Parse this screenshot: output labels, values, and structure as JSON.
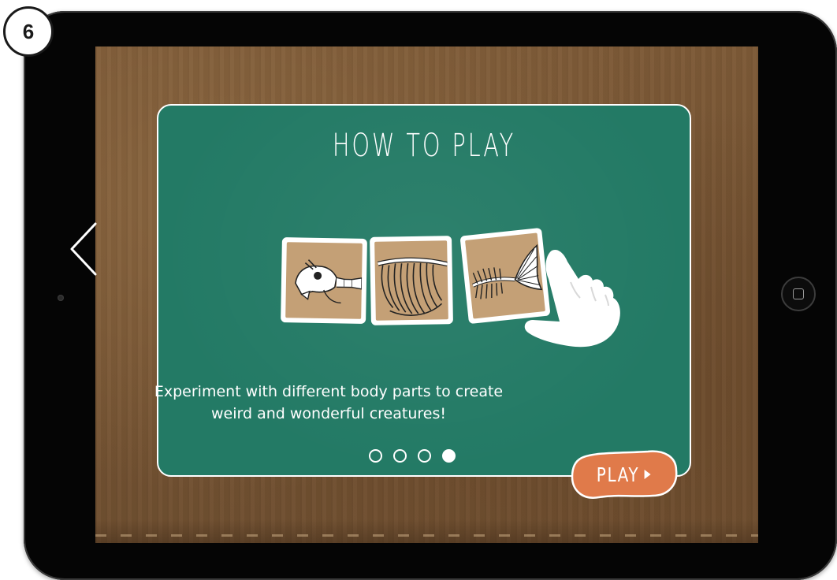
{
  "step_badge": {
    "number": "6"
  },
  "screen": {
    "title": "HOW TO PLAY",
    "instruction_line1": "Experiment with different body parts to create",
    "instruction_line2": "weird and wonderful creatures!",
    "tiles": [
      {
        "icon": "skull-skeleton-icon"
      },
      {
        "icon": "ribcage-skeleton-icon"
      },
      {
        "icon": "fish-tail-skeleton-icon"
      }
    ],
    "pagination": {
      "total": 4,
      "active_index": 3
    },
    "play_button": {
      "label": "PLAY"
    },
    "prev_icon": "chevron-left-icon",
    "hand_icon": "pointing-hand-icon"
  },
  "colors": {
    "board_green": "#237a65",
    "wood_brown": "#7d5a37",
    "tile_tan": "#c4a076",
    "play_orange": "#e07a4a",
    "device_black": "#050505"
  }
}
